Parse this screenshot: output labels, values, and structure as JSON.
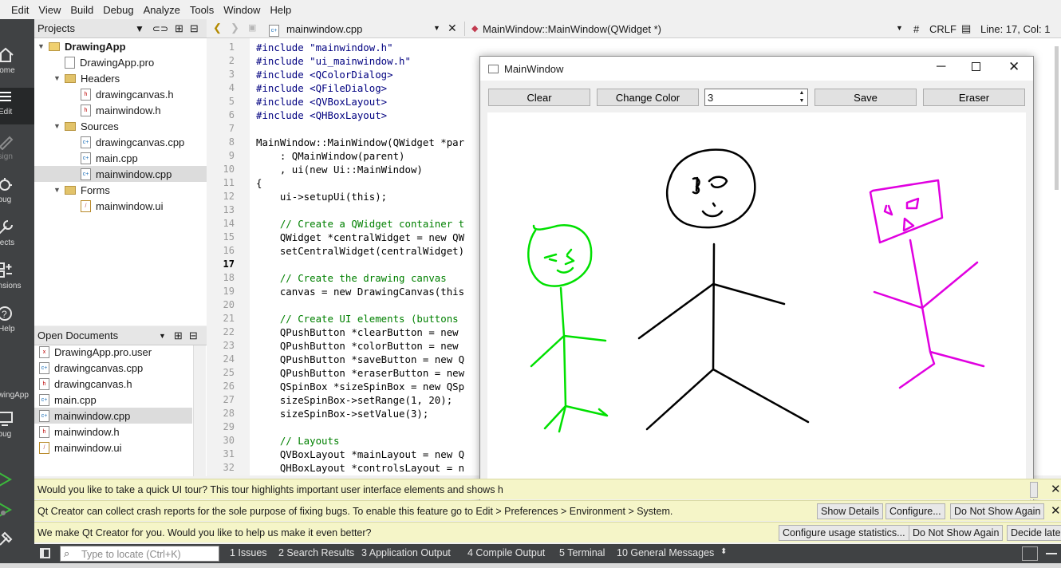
{
  "menu": [
    "Edit",
    "View",
    "Build",
    "Debug",
    "Analyze",
    "Tools",
    "Window",
    "Help"
  ],
  "modes": [
    {
      "label": "lcome",
      "icon": "home-icon"
    },
    {
      "label": "Edit",
      "icon": "edit-icon"
    },
    {
      "label": "esign",
      "icon": "design-icon"
    },
    {
      "label": "ebug",
      "icon": "debug-icon"
    },
    {
      "label": "ojects",
      "icon": "projects-icon"
    },
    {
      "label": "ensions",
      "icon": "extensions-icon"
    },
    {
      "label": "Help",
      "icon": "help-icon"
    },
    {
      "label": "awingApp",
      "icon": "kit-icon"
    },
    {
      "label": "ebug",
      "icon": "monitor-icon"
    }
  ],
  "projects_panel": {
    "title": "Projects",
    "tree": [
      {
        "label": "DrawingApp",
        "level": 0,
        "kind": "project",
        "bold": true
      },
      {
        "label": "DrawingApp.pro",
        "level": 1,
        "kind": "pro"
      },
      {
        "label": "Headers",
        "level": 1,
        "kind": "folder"
      },
      {
        "label": "drawingcanvas.h",
        "level": 2,
        "kind": "h"
      },
      {
        "label": "mainwindow.h",
        "level": 2,
        "kind": "h"
      },
      {
        "label": "Sources",
        "level": 1,
        "kind": "folder"
      },
      {
        "label": "drawingcanvas.cpp",
        "level": 2,
        "kind": "cpp"
      },
      {
        "label": "main.cpp",
        "level": 2,
        "kind": "cpp"
      },
      {
        "label": "mainwindow.cpp",
        "level": 2,
        "kind": "cpp",
        "selected": true
      },
      {
        "label": "Forms",
        "level": 1,
        "kind": "folder"
      },
      {
        "label": "mainwindow.ui",
        "level": 2,
        "kind": "ui"
      }
    ]
  },
  "open_documents": {
    "title": "Open Documents",
    "items": [
      {
        "label": "DrawingApp.pro.user",
        "kind": "user"
      },
      {
        "label": "drawingcanvas.cpp",
        "kind": "cpp"
      },
      {
        "label": "drawingcanvas.h",
        "kind": "h"
      },
      {
        "label": "main.cpp",
        "kind": "cpp"
      },
      {
        "label": "mainwindow.cpp",
        "kind": "cpp",
        "selected": true
      },
      {
        "label": "mainwindow.h",
        "kind": "h"
      },
      {
        "label": "mainwindow.ui",
        "kind": "ui"
      }
    ]
  },
  "editor_toolbar": {
    "file": "mainwindow.cpp",
    "symbol": "MainWindow::MainWindow(QWidget *)",
    "hash": "#",
    "line_ending": "CRLF",
    "position": "Line: 17, Col: 1"
  },
  "editor": {
    "current_line": 17,
    "lines": [
      {
        "n": "1",
        "t": "#include \"mainwindow.h\""
      },
      {
        "n": "2",
        "t": "#include \"ui_mainwindow.h\""
      },
      {
        "n": "3",
        "t": "#include <QColorDialog>"
      },
      {
        "n": "4",
        "t": "#include <QFileDialog>"
      },
      {
        "n": "5",
        "t": "#include <QVBoxLayout>"
      },
      {
        "n": "6",
        "t": "#include <QHBoxLayout>"
      },
      {
        "n": "7",
        "t": ""
      },
      {
        "n": "8",
        "t": "MainWindow::MainWindow(QWidget *par"
      },
      {
        "n": "9",
        "t": "    : QMainWindow(parent)"
      },
      {
        "n": "10",
        "t": "    , ui(new Ui::MainWindow)"
      },
      {
        "n": "11",
        "t": "{"
      },
      {
        "n": "12",
        "t": "    ui->setupUi(this);"
      },
      {
        "n": "13",
        "t": ""
      },
      {
        "n": "14",
        "t": "    // Create a QWidget container t"
      },
      {
        "n": "15",
        "t": "    QWidget *centralWidget = new QW"
      },
      {
        "n": "16",
        "t": "    setCentralWidget(centralWidget)"
      },
      {
        "n": "17",
        "t": ""
      },
      {
        "n": "18",
        "t": "    // Create the drawing canvas"
      },
      {
        "n": "19",
        "t": "    canvas = new DrawingCanvas(this"
      },
      {
        "n": "20",
        "t": ""
      },
      {
        "n": "21",
        "t": "    // Create UI elements (buttons"
      },
      {
        "n": "22",
        "t": "    QPushButton *clearButton = new "
      },
      {
        "n": "23",
        "t": "    QPushButton *colorButton = new "
      },
      {
        "n": "24",
        "t": "    QPushButton *saveButton = new Q"
      },
      {
        "n": "25",
        "t": "    QPushButton *eraserButton = new"
      },
      {
        "n": "26",
        "t": "    QSpinBox *sizeSpinBox = new QSp"
      },
      {
        "n": "27",
        "t": "    sizeSpinBox->setRange(1, 20);"
      },
      {
        "n": "28",
        "t": "    sizeSpinBox->setValue(3);"
      },
      {
        "n": "29",
        "t": ""
      },
      {
        "n": "30",
        "t": "    // Layouts"
      },
      {
        "n": "31",
        "t": "    QVBoxLayout *mainLayout = new Q"
      },
      {
        "n": "32",
        "t": "    QHBoxLayout *controlsLayout = n"
      }
    ]
  },
  "main_window": {
    "title": "MainWindow",
    "buttons": {
      "clear": "Clear",
      "change_color": "Change Color",
      "save": "Save",
      "eraser": "Eraser"
    },
    "spin_value": "3",
    "stroke_colors": {
      "left_figure": "#00e000",
      "middle_figure": "#000000",
      "right_figure": "#e000e0"
    }
  },
  "notifications": [
    {
      "text": "Would you like to take a quick UI tour? This tour highlights important user interface elements and shows h",
      "buttons": []
    },
    {
      "text": "Qt Creator can collect crash reports for the sole purpose of fixing bugs. To enable this feature go to Edit > Preferences > Environment > System.",
      "buttons": [
        "Show Details",
        "Configure...",
        "Do Not Show Again"
      ]
    },
    {
      "text": "We make Qt Creator for you. Would you like to help us make it even better?",
      "buttons": [
        "Configure usage statistics...",
        "Do Not Show Again",
        "Decide later"
      ]
    }
  ],
  "statusbar": {
    "locator_placeholder": "Type to locate (Ctrl+K)",
    "panes": [
      "1  Issues",
      "2  Search Results",
      "3  Application Output",
      "4  Compile Output",
      "5  Terminal",
      "10  General Messages"
    ]
  }
}
